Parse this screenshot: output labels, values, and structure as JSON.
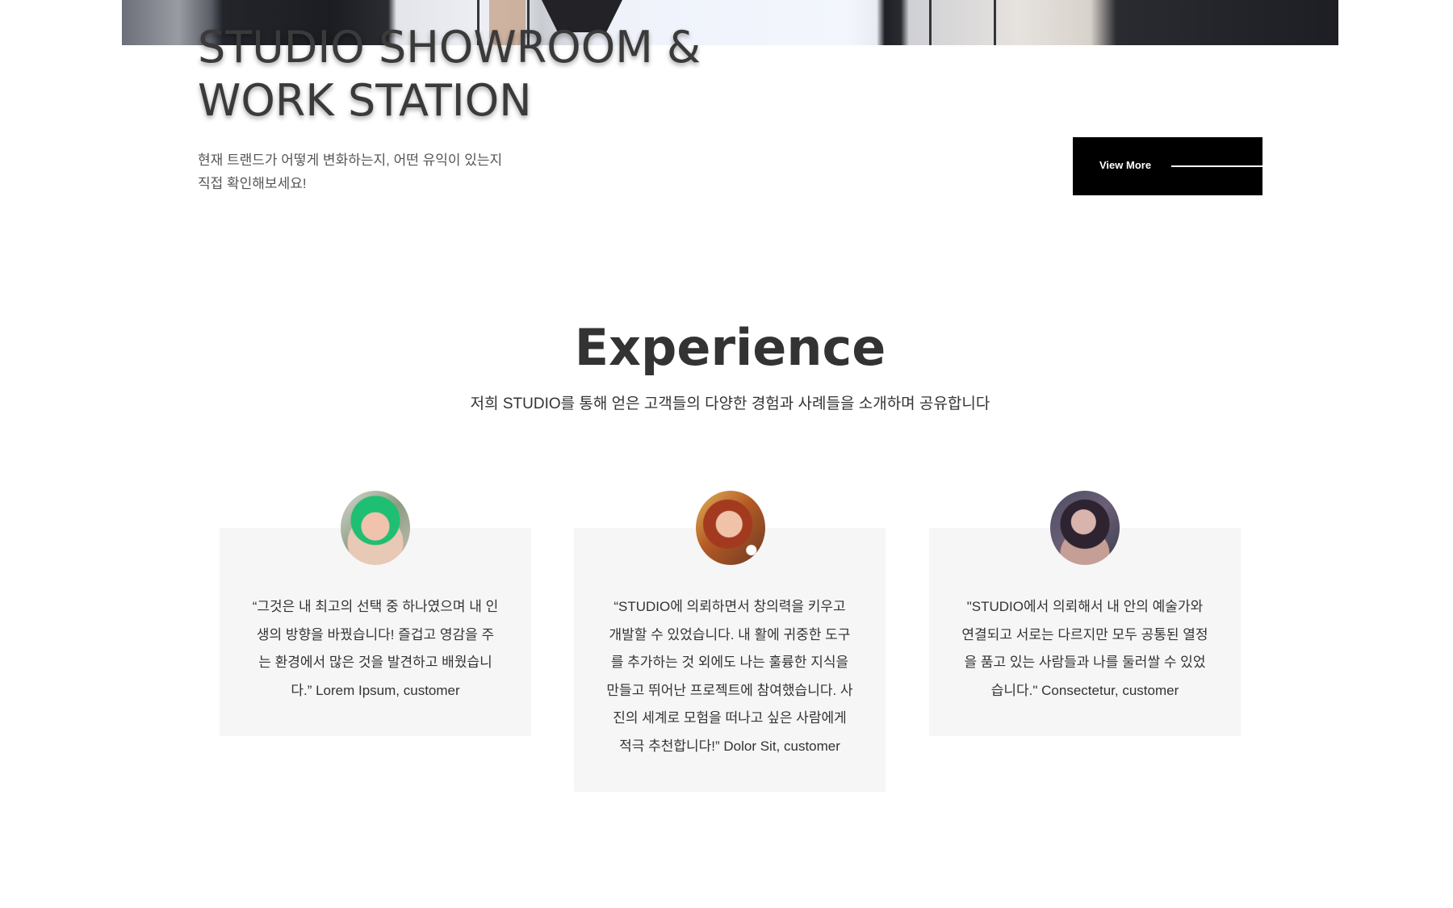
{
  "hero": {
    "title": "STUDIO SHOWROOM &\nWORK STATION",
    "description": "현재 트랜드가 어떻게 변화하는지, 어떤 유익이 있는지\n직접 확인해보세요!",
    "view_more_label": "View More"
  },
  "experience": {
    "title": "Experience",
    "subtitle": "저희 STUDIO를 통해 얻은 고객들의 다양한 경험과 사례들을 소개하며 공유합니다",
    "testimonials": [
      {
        "text": "“그것은 내 최고의 선택 중 하나였으며 내 인생의 방향을 바꿨습니다! 즐겁고 영감을 주는 환경에서 많은 것을 발견하고 배웠습니다.” Lorem Ipsum, customer"
      },
      {
        "text": "“STUDIO에 의뢰하면서 창의력을 키우고 개발할 수 있었습니다. 내 활에 귀중한 도구를 추가하는 것 외에도 나는 훌륭한 지식을 만들고 뛰어난 프로젝트에 참여했습니다. 사진의 세계로 모험을 떠나고 싶은 사람에게 적극 추천합니다!” Dolor Sit, customer"
      },
      {
        "text": "\"STUDIO에서 의뢰해서 내 안의 예술가와 연결되고 서로는 다르지만 모두 공통된 열정을 품고 있는 사람들과 나를 둘러쌀 수 있었습니다.\" Consectetur, customer"
      }
    ]
  },
  "colors": {
    "button_bg": "#000000",
    "card_bg": "#f6f6f6",
    "text_dark": "#333333"
  }
}
